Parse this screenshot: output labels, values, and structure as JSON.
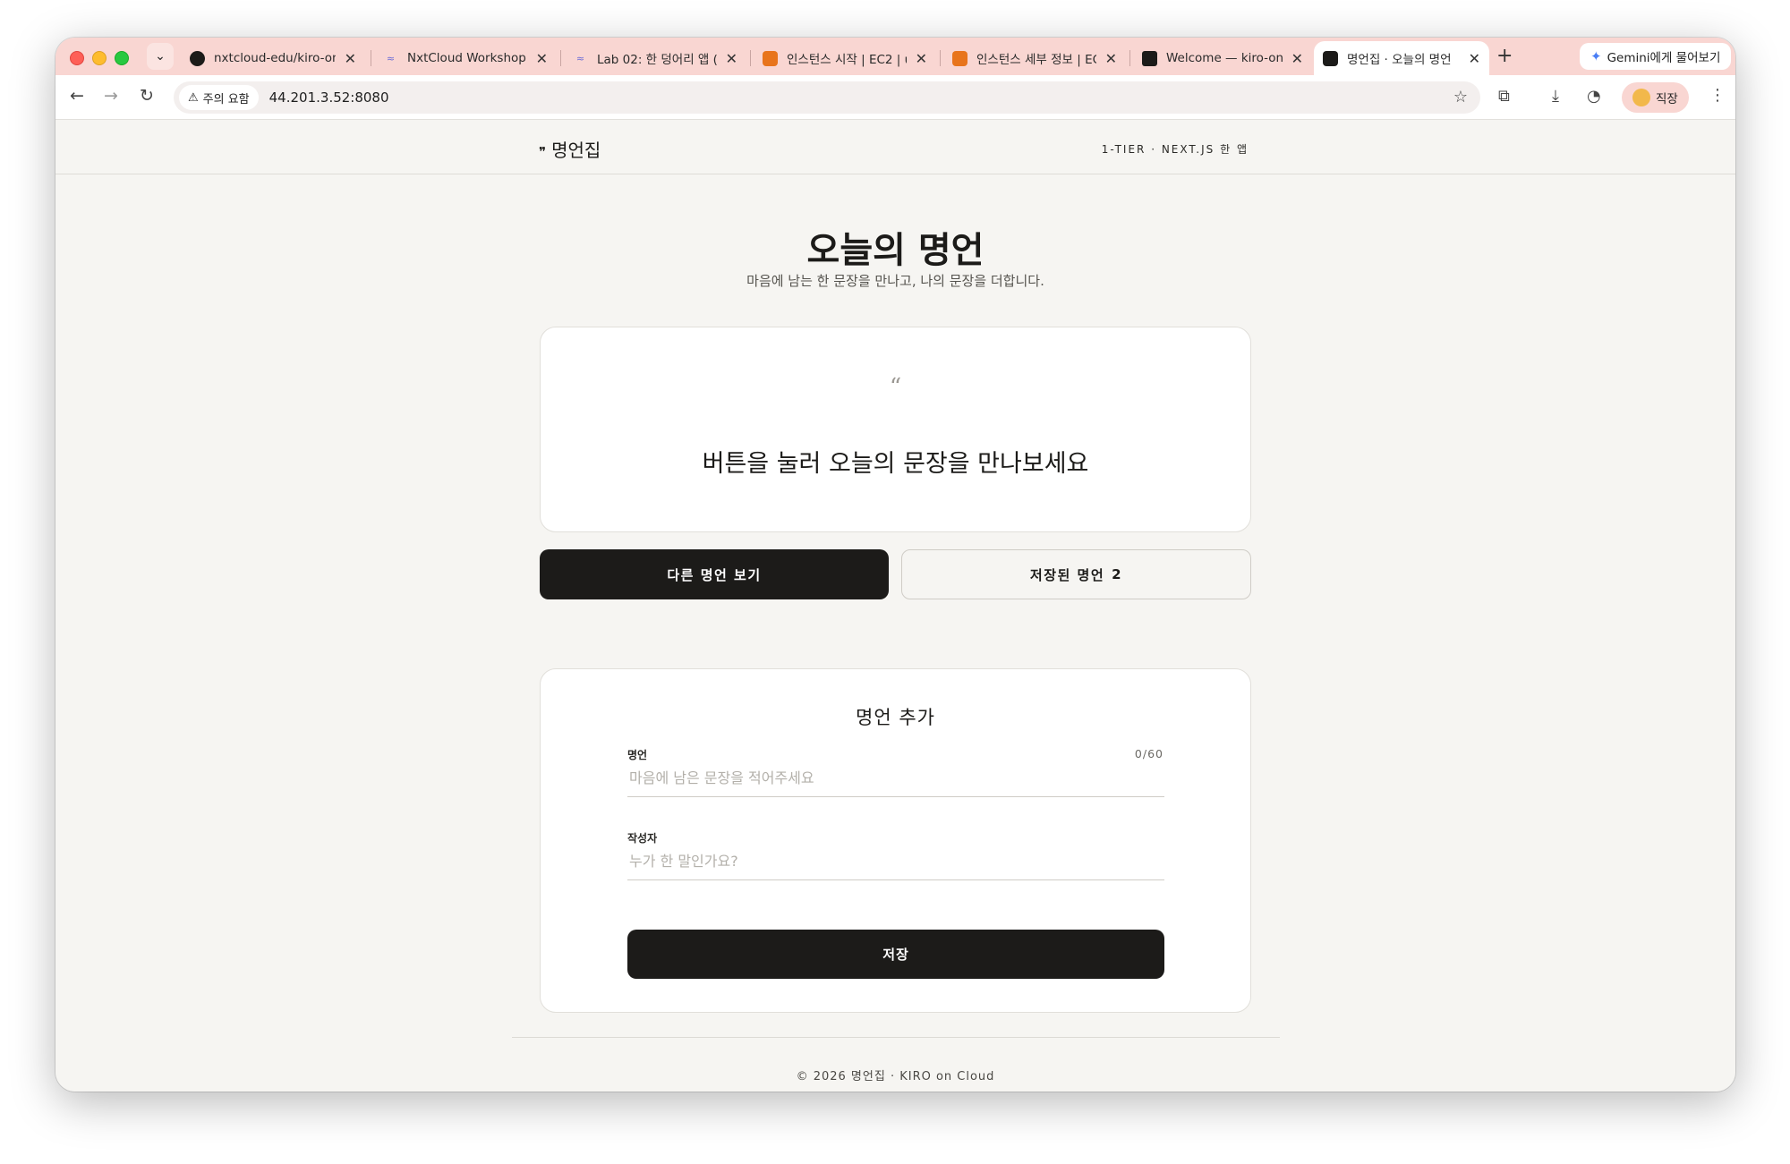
{
  "browser": {
    "tabs": [
      {
        "title": "nxtcloud-edu/kiro-on",
        "icon": "github-icon"
      },
      {
        "title": "NxtCloud Workshop |",
        "icon": "workshop-icon"
      },
      {
        "title": "Lab 02: 한 덩어리 앱 (1",
        "icon": "workshop-icon"
      },
      {
        "title": "인스턴스 시작 | EC2 | u",
        "icon": "aws-icon"
      },
      {
        "title": "인스턴스 세부 정보 | EC",
        "icon": "aws-icon"
      },
      {
        "title": "Welcome — kiro-on-",
        "icon": "coder-icon"
      },
      {
        "title": "명언집 · 오늘의 명언",
        "icon": "quote-app-icon"
      }
    ],
    "gemini_label": "Gemini에게 물어보기",
    "security_chip": "주의 요함",
    "url": "44.201.3.52:8080",
    "profile_label": "직장",
    "colors": {
      "tabstrip": "#f9d6d2",
      "page_bg": "#f6f5f2",
      "accent": "#1c1b19"
    }
  },
  "site": {
    "brand_mark": "❞",
    "brand": "명언집",
    "tagline": "1-TIER · NEXT.JS 한 앱"
  },
  "hero": {
    "title": "오늘의 명언",
    "subtitle": "마음에 남는 한 문장을 만나고, 나의 문장을 더합니다."
  },
  "quote_card": {
    "mark": "“",
    "text": "버튼을 눌러 오늘의 문장을 만나보세요"
  },
  "actions": {
    "next_quote": "다른 명언 보기",
    "saved_label": "저장된 명언",
    "saved_count": "2"
  },
  "form": {
    "title": "명언 추가",
    "quote_label": "명언",
    "quote_counter": "0/60",
    "quote_placeholder": "마음에 남은 문장을 적어주세요",
    "author_label": "작성자",
    "author_placeholder": "누가 한 말인가요?",
    "save_label": "저장"
  },
  "footer": {
    "text": "© 2026 명언집 · KIRO on Cloud"
  }
}
